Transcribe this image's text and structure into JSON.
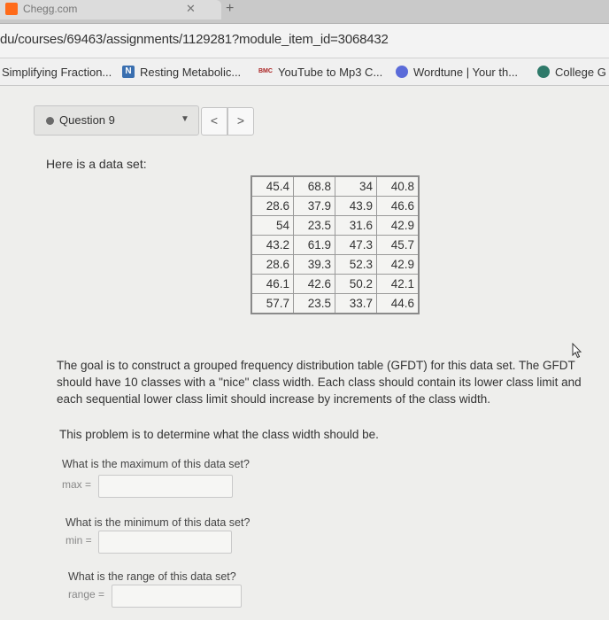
{
  "browser": {
    "tab_title": "Chegg.com",
    "url": "du/courses/69463/assignments/1129281?module_item_id=3068432",
    "bookmarks": [
      {
        "label": "Simplifying Fraction...",
        "icon": "none"
      },
      {
        "label": "Resting Metabolic...",
        "icon": "n-icon"
      },
      {
        "label": "YouTube to Mp3 C...",
        "icon": "bmc-icon"
      },
      {
        "label": "Wordtune | Your th...",
        "icon": "wordtune-icon"
      },
      {
        "label": "College G",
        "icon": "collegeboard-icon"
      }
    ]
  },
  "question_nav": {
    "label": "Question 9",
    "prev": "<",
    "next": ">"
  },
  "content": {
    "intro": "Here is a data set:",
    "table": [
      [
        "45.4",
        "68.8",
        "34",
        "40.8"
      ],
      [
        "28.6",
        "37.9",
        "43.9",
        "46.6"
      ],
      [
        "54",
        "23.5",
        "31.6",
        "42.9"
      ],
      [
        "43.2",
        "61.9",
        "47.3",
        "45.7"
      ],
      [
        "28.6",
        "39.3",
        "52.3",
        "42.9"
      ],
      [
        "46.1",
        "42.6",
        "50.2",
        "42.1"
      ],
      [
        "57.7",
        "23.5",
        "33.7",
        "44.6"
      ]
    ],
    "goal": "The goal is to construct a grouped frequency distribution table (GFDT) for this data set. The GFDT should have 10 classes with a \"nice\" class width. Each class should contain its lower class limit and each sequential lower class limit should increase by increments of the class width.",
    "task": "This problem is to determine what the class width should be.",
    "questions": [
      {
        "prompt": "What is the maximum of this data set?",
        "inline_label": "max =",
        "value": ""
      },
      {
        "prompt": "What is the minimum of this data set?",
        "inline_label": "min =",
        "value": ""
      },
      {
        "prompt": "What is the range of this data set?",
        "inline_label": "range =",
        "value": ""
      }
    ]
  }
}
